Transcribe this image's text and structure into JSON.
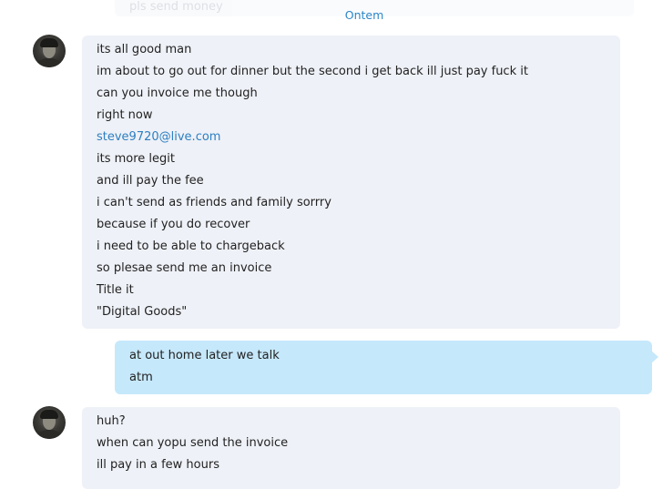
{
  "previous_message": {
    "text": "pls send money"
  },
  "date_divider": "Ontem",
  "conversation": {
    "group1": {
      "lines": [
        "its all good man",
        "im about to go out for dinner but the second i get back ill just pay fuck it",
        "can you invoice me though",
        "right now",
        "steve9720@live.com",
        "its more legit",
        "and ill pay the fee",
        "i can't send as friends and family sorrry",
        "because if you do recover",
        "i need to be able to chargeback",
        "so plesae send me an invoice",
        "Title it",
        "\"Digital Goods\""
      ]
    },
    "group2": {
      "lines": [
        "at out home later we talk",
        "atm"
      ]
    },
    "group3": {
      "lines": [
        "huh?",
        "when can yopu send the invoice",
        "ill pay in a few hours"
      ]
    }
  },
  "colors": {
    "incoming_bubble": "#eef1f7",
    "outgoing_bubble": "#c6e8fb",
    "link": "#2d7fc2",
    "date_divider": "#2d87c9"
  },
  "icons": {
    "contact_avatar": "user-avatar-photo"
  }
}
